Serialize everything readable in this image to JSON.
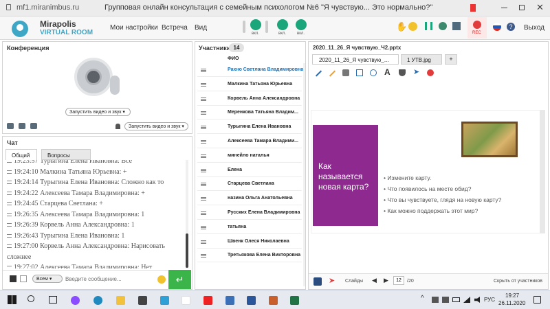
{
  "browser": {
    "url": "mf1.miranimbus.ru",
    "title": "Групповая онлайн консультация с семейным психологом №6 \"Я чувствую... Это нормально?\""
  },
  "header": {
    "logo_line1": "Mirapolis",
    "logo_line2": "VIRTUAL ROOM",
    "menu": [
      "Мои настройки",
      "Встреча",
      "Вид"
    ],
    "mic_label": "вкл.",
    "cam_label": "вкл.",
    "screen_label": "вкл.",
    "rec_label": "REC",
    "exit_label": "Выход"
  },
  "conference": {
    "title": "Конференция",
    "start_av": "Запустить видео и звук",
    "start_av2": "Запустить видео и звук"
  },
  "chat": {
    "title": "Чат",
    "tabs": [
      "Общий",
      "Вопросы"
    ],
    "messages": [
      {
        "time": "19:23:57",
        "author": "Турыгина  Елена  Ивановна:",
        "text": "Все"
      },
      {
        "time": "19:24:10",
        "author": "Малкина Татьяна  Юрьевна:",
        "text": "+"
      },
      {
        "time": "19:24:14",
        "author": "Турыгина  Елена  Ивановна:",
        "text": "Сложно как то"
      },
      {
        "time": "19:24:22",
        "author": "Алексеева   Тамара  Владимировна:",
        "text": "+"
      },
      {
        "time": "19:24:45",
        "author": "Старцева  Светлана:",
        "text": "+"
      },
      {
        "time": "19:26:35",
        "author": "Алексеева   Тамара  Владимировна:",
        "text": "1"
      },
      {
        "time": "19:26:39",
        "author": "Корвель Анна  Александровна:",
        "text": "1"
      },
      {
        "time": "19:26:43",
        "author": "Турыгина  Елена  Ивановна:",
        "text": "1"
      },
      {
        "time": "19:27:00",
        "author": "Корвель Анна  Александровна:",
        "text": "Нарисовать"
      },
      {
        "time": "",
        "author": "",
        "text": "сложнее"
      },
      {
        "time": "19:27:02",
        "author": "Алексеева   Тамара  Владимировна:",
        "text": "Нет"
      }
    ],
    "recipient": "Всем",
    "input_placeholder": "Введите сообщение..."
  },
  "participants": {
    "title": "Участники",
    "count": "14",
    "column": "ФИО",
    "names": [
      "Рахно Светлана  Владимировна",
      "Малкина Татьяна  Юрьевна",
      "Корвель Анна  Александровна",
      "Меренкова  Татьяна  Владим...",
      "Турыгина  Елена  Ивановна",
      "Алексеева   Тамара  Владими...",
      "минейло  наталья",
      "Елена",
      "Старцева  Светлана",
      "назина  Ольга Анатольевна",
      "Русских Елена Владимировна",
      "татьяна",
      "Швенк  Олеся Николаевна",
      "Третьякова  Елена Викторовна"
    ]
  },
  "presentation": {
    "title": "2020_11_26_Я чувствую_Ч2.pptx",
    "tabs": [
      "2020_11_26_Я чувствую_...",
      "1 УТВ.jpg",
      "+"
    ],
    "slide_heading": "Как называется новая карта?",
    "bullets": [
      "Измените карту.",
      "Что появилось на месте обид?",
      "Что вы чувствуете, глядя на новую карту?",
      "Как можно поддержать этот мир?"
    ],
    "slides_label": "Слайды",
    "page_current": "12",
    "page_total": "/20",
    "hide_label": "Скрыть от участников"
  },
  "taskbar": {
    "lang": "РУС",
    "time": "19:27",
    "date": "26.11.2020"
  },
  "colors": {
    "accent": "#1aa57a",
    "slide_purple": "#8e2a8f",
    "name_blue": "#1a6fb5"
  }
}
